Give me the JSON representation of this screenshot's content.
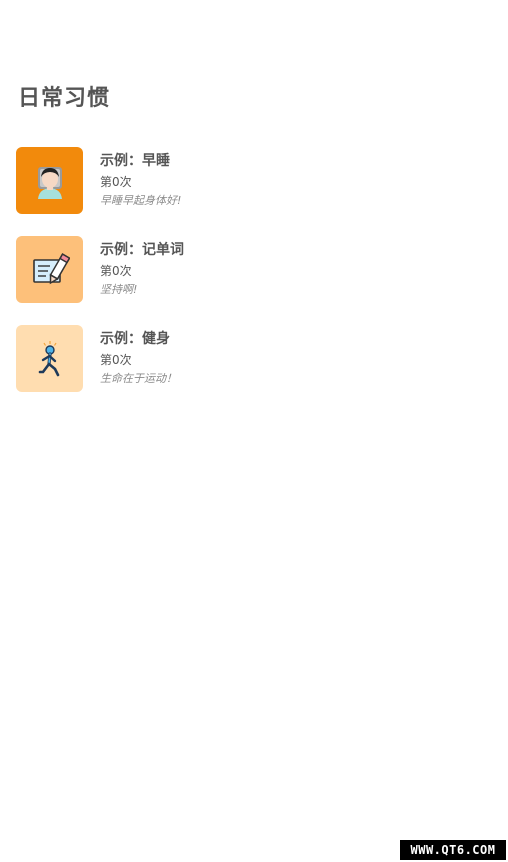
{
  "header": {
    "title": "日常习惯"
  },
  "habits": [
    {
      "name": "示例：早睡",
      "count": "第0次",
      "motto": "早睡早起身体好!",
      "icon": "sleeping-person-icon",
      "icon_bg": "#F28A0C"
    },
    {
      "name": "示例：记单词",
      "count": "第0次",
      "motto": "坚持啊!",
      "icon": "notebook-pencil-icon",
      "icon_bg": "#FDC07A"
    },
    {
      "name": "示例：健身",
      "count": "第0次",
      "motto": "生命在于运动！",
      "icon": "running-person-icon",
      "icon_bg": "#FFDDB0"
    }
  ],
  "watermark": {
    "text": "WWW.QT6.COM"
  }
}
